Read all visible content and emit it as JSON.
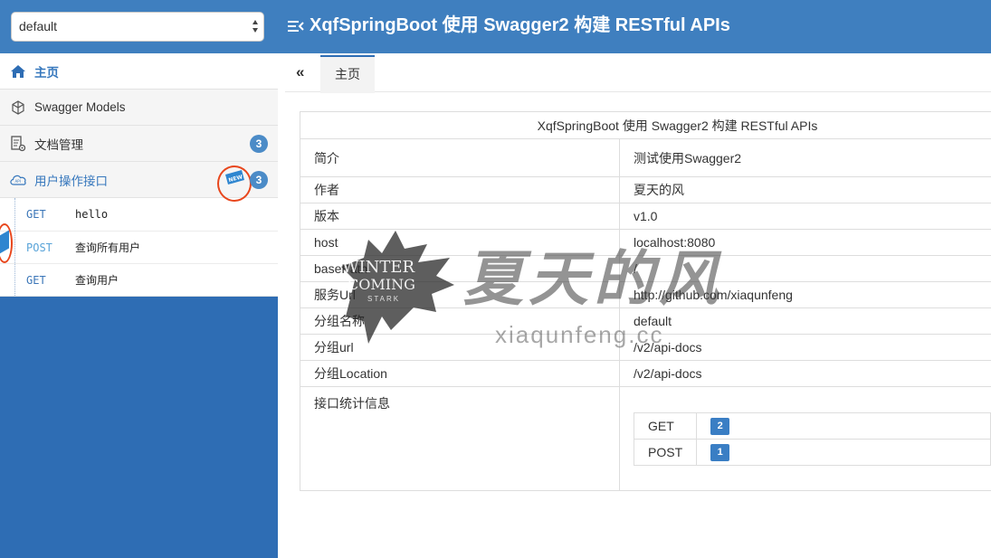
{
  "header": {
    "group_select": "default",
    "title": "XqfSpringBoot 使用 Swagger2 构建 RESTful APIs",
    "bg_color": "#3f7fbf"
  },
  "sidebar": {
    "items": [
      {
        "label": "主页",
        "icon": "home-icon"
      },
      {
        "label": "Swagger Models",
        "icon": "cube-icon"
      },
      {
        "label": "文档管理",
        "icon": "document-settings-icon",
        "badge": "3"
      },
      {
        "label": "用户操作接口",
        "icon": "api-cloud-icon",
        "badge": "3",
        "tag": "NEW"
      }
    ],
    "operations": [
      {
        "method": "GET",
        "summary": "hello"
      },
      {
        "method": "POST",
        "summary": "查询所有用户"
      },
      {
        "method": "GET",
        "summary": "查询用户"
      }
    ],
    "side_tag": "NEW"
  },
  "tabs": {
    "collapse": "«",
    "home": "主页"
  },
  "info": {
    "title": "XqfSpringBoot 使用 Swagger2 构建 RESTful APIs",
    "rows": [
      {
        "label": "简介",
        "value": "测试使用Swagger2"
      },
      {
        "label": "作者",
        "value": "夏天的风"
      },
      {
        "label": "版本",
        "value": "v1.0"
      },
      {
        "label": "host",
        "value": "localhost:8080"
      },
      {
        "label": "basePath",
        "value": "/"
      },
      {
        "label": "服务Url",
        "value": "http://github.com/xiaqunfeng"
      },
      {
        "label": "分组名称",
        "value": "default"
      },
      {
        "label": "分组url",
        "value": "/v2/api-docs"
      },
      {
        "label": "分组Location",
        "value": "/v2/api-docs"
      }
    ],
    "stats_label": "接口统计信息",
    "stats": [
      {
        "method": "GET",
        "count": "2"
      },
      {
        "method": "POST",
        "count": "1"
      }
    ]
  },
  "watermark": {
    "big": "夏天的风",
    "small": "xiaqunfeng.cc",
    "logo_line1": "WINTER",
    "logo_line2": "COMING",
    "logo_line3": "STARK"
  }
}
